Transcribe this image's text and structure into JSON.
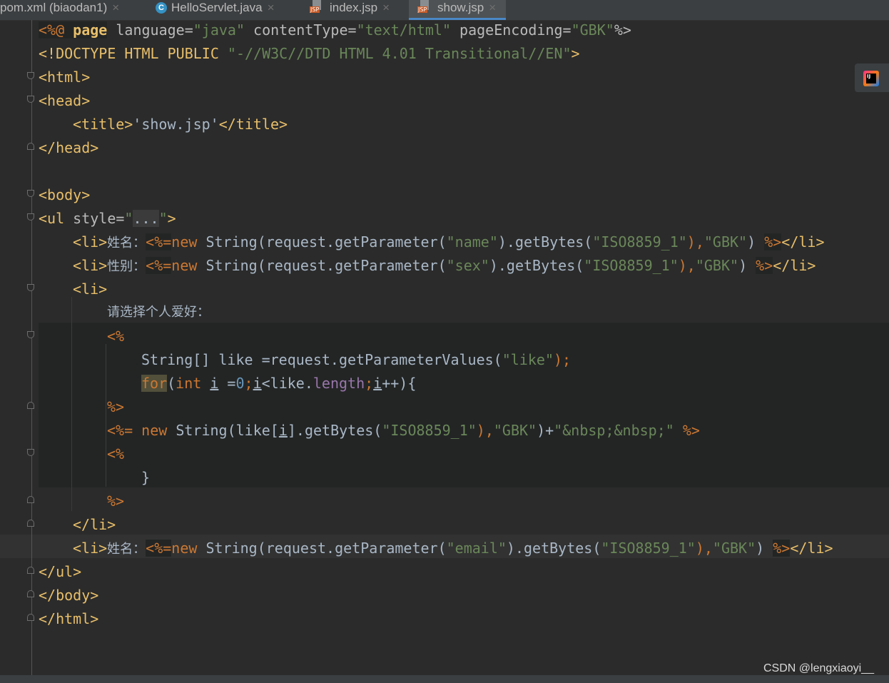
{
  "tabs": [
    {
      "label": "pom.xml (biaodan1)",
      "icon": "maven-file-icon",
      "active": false
    },
    {
      "label": "HelloServlet.java",
      "icon": "java-class-icon",
      "active": false
    },
    {
      "label": "index.jsp",
      "icon": "jsp-file-icon",
      "active": false
    },
    {
      "label": "show.jsp",
      "icon": "jsp-file-icon",
      "active": true
    }
  ],
  "icons": {
    "java_class": "C",
    "jsp_badge": "JSP",
    "ij_logo": "IJ",
    "close": "×"
  },
  "code": {
    "l1": {
      "a": "<%@ ",
      "b": "page",
      "c": " language=",
      "d": "\"java\"",
      "e": " contentType=",
      "f": "\"text/html\"",
      "g": " pageEncoding=",
      "h": "\"GBK\"",
      "i": "%>"
    },
    "l2": {
      "a": "<!DOCTYPE HTML PUBLIC ",
      "b": "\"-//W3C//DTD HTML 4.01 Transitional//EN\"",
      "c": ">"
    },
    "l3": "<html>",
    "l4": "<head>",
    "l5": {
      "a": "<title>",
      "b": "'show.jsp'",
      "c": "</title>"
    },
    "l6": "</head>",
    "l8": "<body>",
    "l9": {
      "a": "<ul",
      "b": " style=",
      "c": "\"",
      "d": "...",
      "e": "\"",
      "f": ">"
    },
    "l10": {
      "a": "<li>",
      "b": "姓名：",
      "c": "<%=",
      "d": "new",
      "e": " String(request.getParameter(",
      "f": "\"name\"",
      "g": ").getBytes(",
      "h": "\"ISO8859_1\"",
      "i": "),",
      "j": "\"GBK\"",
      "k": ") ",
      "l": "%>",
      "m": "</li>"
    },
    "l11": {
      "a": "<li>",
      "b": "性别：",
      "c": "<%=",
      "d": "new",
      "e": " String(request.getParameter(",
      "f": "\"sex\"",
      "g": ").getBytes(",
      "h": "\"ISO8859_1\"",
      "i": "),",
      "j": "\"GBK\"",
      "k": ") ",
      "l": "%>",
      "m": "</li>"
    },
    "l12": "<li>",
    "l13": "请选择个人爱好：",
    "l14": "<%",
    "l15": {
      "a": "String[] like =request.getParameterValues(",
      "b": "\"like\"",
      "c": ");"
    },
    "l16": {
      "a": "for",
      "b": "(",
      "c": "int",
      "d": " ",
      "e": "i",
      "f": " =",
      "g": "0",
      "h": ";",
      "i": "i",
      "j": "<like.",
      "k": "length",
      "l": ";",
      "m": "i",
      "n": "++){"
    },
    "l17": "%>",
    "l18": {
      "a": "<%= ",
      "b": "new",
      "c": " String(like[",
      "d": "i",
      "e": "].getBytes(",
      "f": "\"ISO8859_1\"",
      "g": "),",
      "h": "\"GBK\"",
      "i": ")+",
      "j": "\"&nbsp;&nbsp;\"",
      "k": " %>"
    },
    "l19": "<%",
    "l20": "}",
    "l21": "%>",
    "l22": "</li>",
    "l23": {
      "a": "<li>",
      "b": "姓名：",
      "c": "<%=",
      "d": "new",
      "e": " String(request.getParameter(",
      "f": "\"email\"",
      "g": ").getBytes(",
      "h": "\"ISO8859_1\"",
      "i": "),",
      "j": "\"GBK\"",
      "k": ") ",
      "l": "%>",
      "m": "</li>"
    },
    "l24": "</ul>",
    "l25": "</body>",
    "l26": "</html>"
  },
  "watermark": "CSDN @lengxiaoyi__",
  "colors": {
    "background": "#2b2b2b",
    "tag": "#e8bf6a",
    "keyword": "#cc7832",
    "string": "#6a8759",
    "text": "#a9b7c6",
    "field": "#9876aa",
    "number": "#6897bb"
  }
}
